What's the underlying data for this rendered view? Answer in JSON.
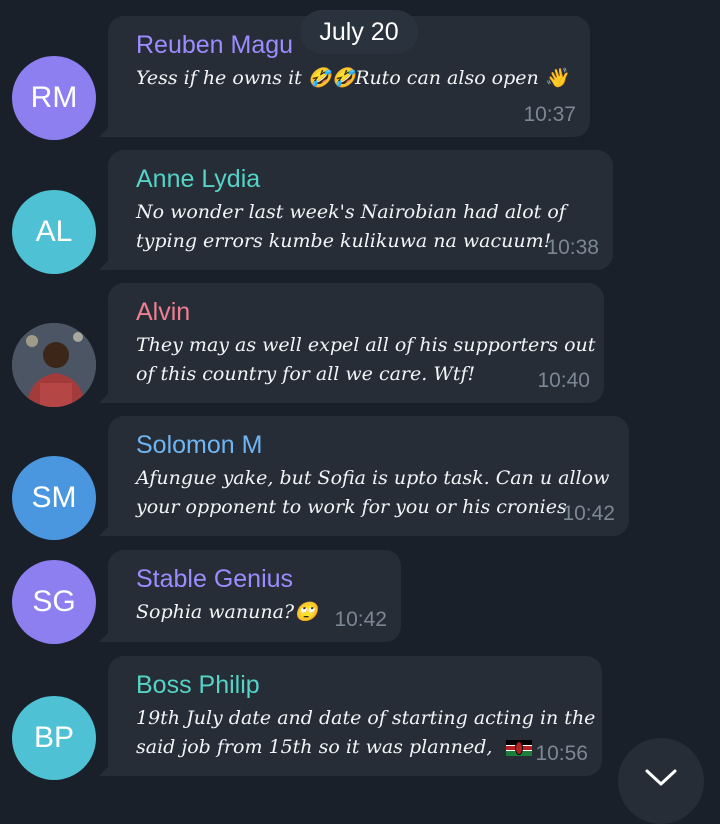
{
  "date_label": "July 20",
  "colors": {
    "background": "#1a2029",
    "bubble": "#262d37",
    "text": "#f2f4f7",
    "time": "#7c8794"
  },
  "messages": [
    {
      "initials": "RM",
      "avatar_color": "#8d7ff0",
      "sender": "Reuben Magu",
      "sender_color": "#9b8cff",
      "lines": [
        "Yess if he owns it 🤣🤣Ruto can also open 👋"
      ],
      "time": "10:37"
    },
    {
      "initials": "AL",
      "avatar_color": "#4fc1d4",
      "sender": "Anne Lydia",
      "sender_color": "#55d3c5",
      "lines": [
        "No wonder last week's Nairobian had alot of",
        "typing errors kumbe kulikuwa na wacuum!"
      ],
      "time": "10:38"
    },
    {
      "initials": "",
      "avatar_color": "#5a6270",
      "avatar_icon": "user-photo",
      "sender": "Alvin",
      "sender_color": "#f07f92",
      "lines": [
        "They may as well expel all of his supporters out",
        "of this country for all we care. Wtf!"
      ],
      "time": "10:40"
    },
    {
      "initials": "SM",
      "avatar_color": "#4a97e0",
      "sender": "Solomon M",
      "sender_color": "#6fb5f2",
      "lines": [
        "Afungue yake, but Sofia is upto task. Can u allow",
        "your opponent to work for you or his cronies"
      ],
      "time": "10:42"
    },
    {
      "initials": "SG",
      "avatar_color": "#8d7ff0",
      "sender": "Stable Genius",
      "sender_color": "#9b8cff",
      "lines": [
        "Sophia wanuna?🙄"
      ],
      "time": "10:42"
    },
    {
      "initials": "BP",
      "avatar_color": "#4fc1d4",
      "sender": "Boss Philip",
      "sender_color": "#55d3c5",
      "lines": [
        "19th July date and date of starting acting in the",
        "said job from 15th so it was planned, "
      ],
      "flag_icon": "kenya-flag-icon",
      "time": "10:56"
    }
  ]
}
